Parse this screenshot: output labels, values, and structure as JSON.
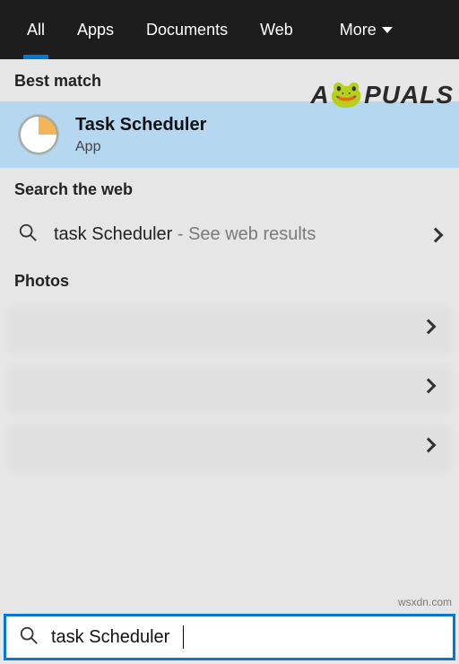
{
  "tabs": {
    "all": "All",
    "apps": "Apps",
    "documents": "Documents",
    "web": "Web",
    "more": "More"
  },
  "sections": {
    "best_match": "Best match",
    "search_web": "Search the web",
    "photos": "Photos"
  },
  "best_match": {
    "title": "Task Scheduler",
    "subtitle": "App"
  },
  "web_result": {
    "query": "task Scheduler",
    "hint": " - See web results"
  },
  "searchbox": {
    "value": "task Scheduler"
  },
  "watermark": {
    "left": "A",
    "right": "PUALS"
  },
  "credit": "wsxdn.com"
}
